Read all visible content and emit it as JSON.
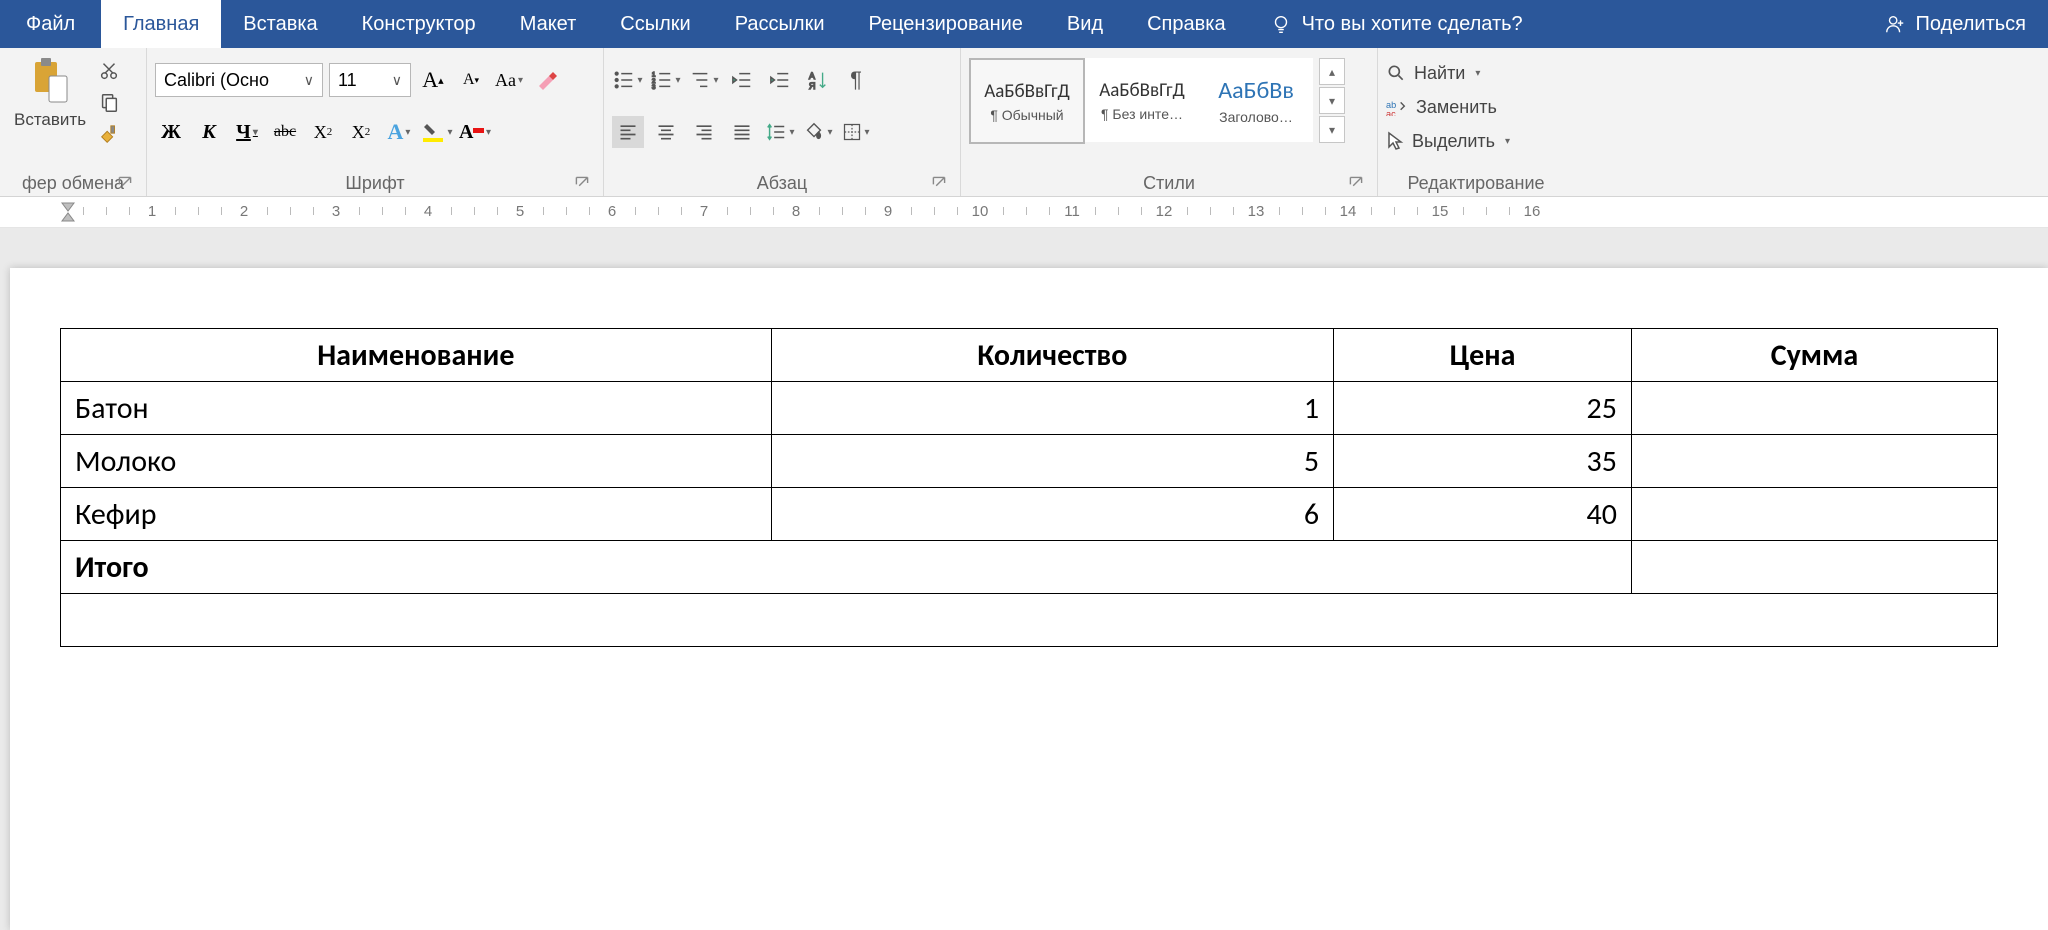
{
  "tabs": {
    "file": "Файл",
    "home": "Главная",
    "insert": "Вставка",
    "design": "Конструктор",
    "layout": "Макет",
    "references": "Ссылки",
    "mailings": "Рассылки",
    "review": "Рецензирование",
    "view": "Вид",
    "help": "Справка",
    "tell_me": "Что вы хотите сделать?",
    "share": "Поделиться"
  },
  "ribbon": {
    "clipboard": {
      "label": "фер обмена",
      "paste": "Вставить"
    },
    "font": {
      "label": "Шрифт",
      "name": "Calibri (Осно",
      "size": "11",
      "bold": "Ж",
      "italic": "К",
      "underline": "Ч",
      "strike": "abc"
    },
    "paragraph": {
      "label": "Абзац"
    },
    "styles": {
      "label": "Стили",
      "sample": "АаБбВвГгД",
      "sample_h1": "АаБбВв",
      "normal": "¶ Обычный",
      "no_spacing": "¶ Без инте…",
      "heading1": "Заголово…"
    },
    "editing": {
      "label": "Редактирование",
      "find": "Найти",
      "replace": "Заменить",
      "select": "Выделить"
    }
  },
  "ruler": {
    "marks": [
      "1",
      "2",
      "3",
      "4",
      "5",
      "6",
      "7",
      "8",
      "9",
      "10",
      "11",
      "12",
      "13",
      "14",
      "15",
      "16"
    ]
  },
  "table": {
    "headers": [
      "Наименование",
      "Количество",
      "Цена",
      "Сумма"
    ],
    "rows": [
      {
        "name": "Батон",
        "qty": "1",
        "price": "25",
        "sum": ""
      },
      {
        "name": "Молоко",
        "qty": "5",
        "price": "35",
        "sum": ""
      },
      {
        "name": "Кефир",
        "qty": "6",
        "price": "40",
        "sum": ""
      }
    ],
    "total_label": "Итого"
  }
}
